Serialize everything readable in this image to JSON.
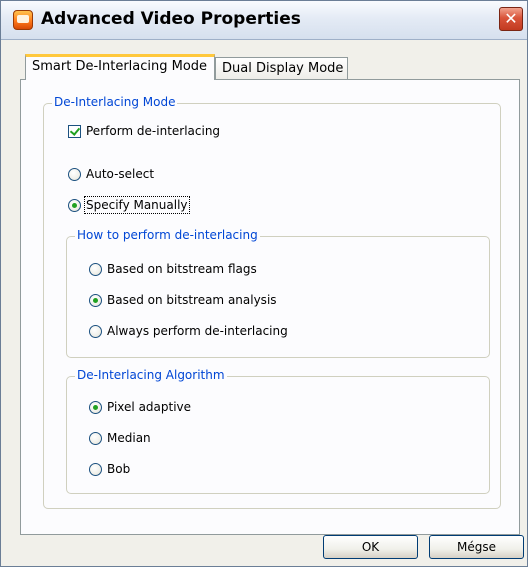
{
  "window": {
    "title": "Advanced Video Properties",
    "close_glyph": "✕"
  },
  "tabs": [
    {
      "label": "Smart De-Interlacing Mode",
      "active": true
    },
    {
      "label": "Dual Display Mode",
      "active": false
    }
  ],
  "deinterlacing_mode": {
    "legend": "De-Interlacing Mode",
    "perform_checkbox": {
      "label": "Perform de-interlacing",
      "checked": true
    },
    "options": [
      {
        "label": "Auto-select",
        "checked": false
      },
      {
        "label": "Specify Manually",
        "checked": true
      }
    ]
  },
  "how_to_perform": {
    "legend": "How to perform de-interlacing",
    "options": [
      {
        "label": "Based on bitstream flags",
        "checked": false
      },
      {
        "label": "Based on bitstream analysis",
        "checked": true
      },
      {
        "label": "Always perform de-interlacing",
        "checked": false
      }
    ]
  },
  "algorithm": {
    "legend": "De-Interlacing Algorithm",
    "options": [
      {
        "label": "Pixel adaptive",
        "checked": true
      },
      {
        "label": "Median",
        "checked": false
      },
      {
        "label": "Bob",
        "checked": false
      }
    ]
  },
  "buttons": {
    "ok": "OK",
    "cancel": "Mégse"
  },
  "colors": {
    "accent": "#0046d5",
    "check": "#21a121",
    "tab_highlight": "#ffc83c"
  },
  "icons": [
    "app-icon",
    "close-icon"
  ]
}
